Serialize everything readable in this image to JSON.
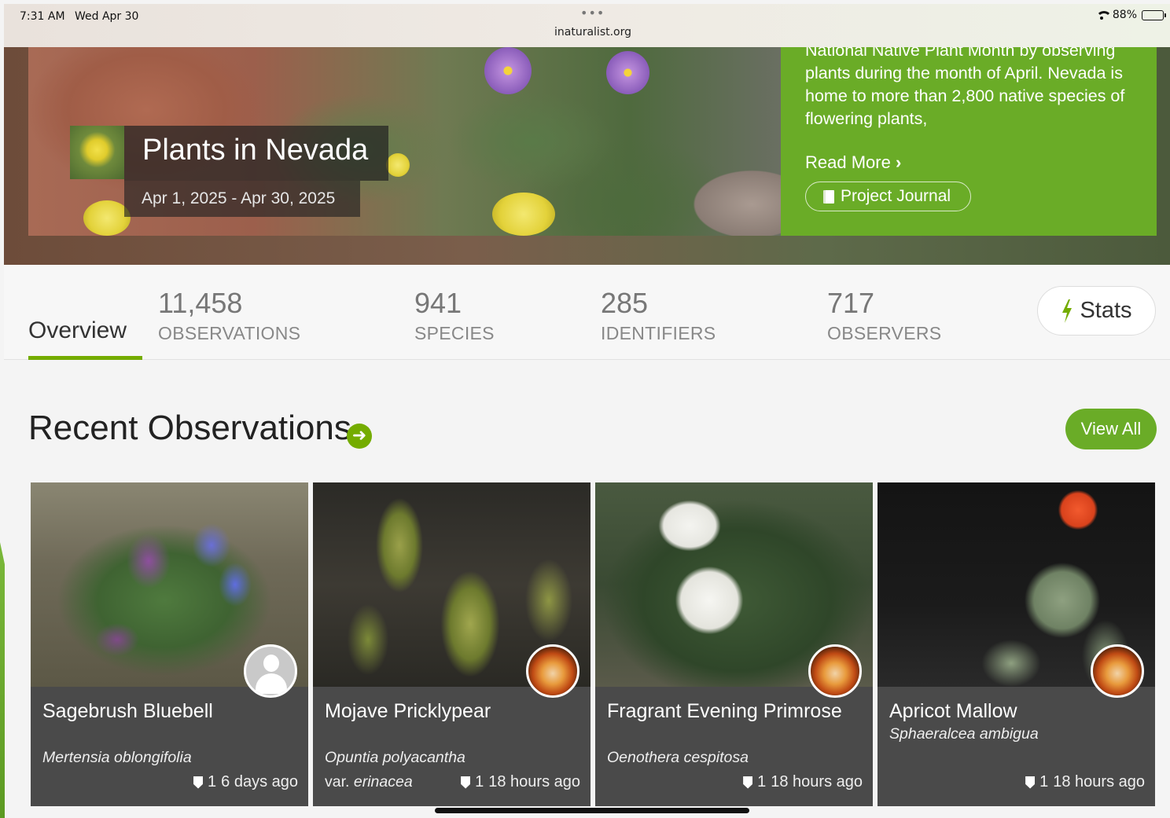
{
  "status_bar": {
    "time": "7:31 AM",
    "date": "Wed Apr 30",
    "dots": "•••",
    "url": "inaturalist.org",
    "battery": "88%",
    "battery_level": 0.88
  },
  "banner": {
    "title": "Plants in Nevada",
    "date_range": "Apr 1, 2025 - Apr 30, 2025",
    "description": "National Native Plant Month by observing plants during the month of April. Nevada is home to more than 2,800 native species of flowering plants,",
    "read_more": "Read More",
    "read_more_chevron": "›",
    "journal_button": "Project Journal"
  },
  "stats": {
    "overview_tab": "Overview",
    "items": [
      {
        "value": "11,458",
        "label": "OBSERVATIONS"
      },
      {
        "value": "941",
        "label": "SPECIES"
      },
      {
        "value": "285",
        "label": "IDENTIFIERS"
      },
      {
        "value": "717",
        "label": "OBSERVERS"
      }
    ],
    "stats_button": "Stats"
  },
  "recent": {
    "title": "Recent Observations",
    "arrow": "➜",
    "view_all": "View All",
    "cards": [
      {
        "common": "Sagebrush Bluebell",
        "scientific": "Mertensia oblongifolia",
        "ids": "1",
        "time": "6 days ago",
        "avatar": "default-user-icon"
      },
      {
        "common": "Mojave Pricklypear",
        "scientific": "Opuntia polyacantha",
        "var_prefix": "var.",
        "var_name": "erinacea",
        "ids": "1",
        "time": "18 hours ago",
        "avatar": "flower-avatar"
      },
      {
        "common": "Fragrant Evening Primrose",
        "scientific": "Oenothera cespitosa",
        "ids": "1",
        "time": "18 hours ago",
        "avatar": "flower-avatar"
      },
      {
        "common": "Apricot Mallow",
        "scientific": "Sphaeralcea ambigua",
        "ids": "1",
        "time": "18 hours ago",
        "avatar": "flower-avatar"
      }
    ]
  },
  "colors": {
    "brand_green": "#74ac00",
    "panel_green": "#6aac27",
    "card_bg": "#4a4a4a"
  }
}
